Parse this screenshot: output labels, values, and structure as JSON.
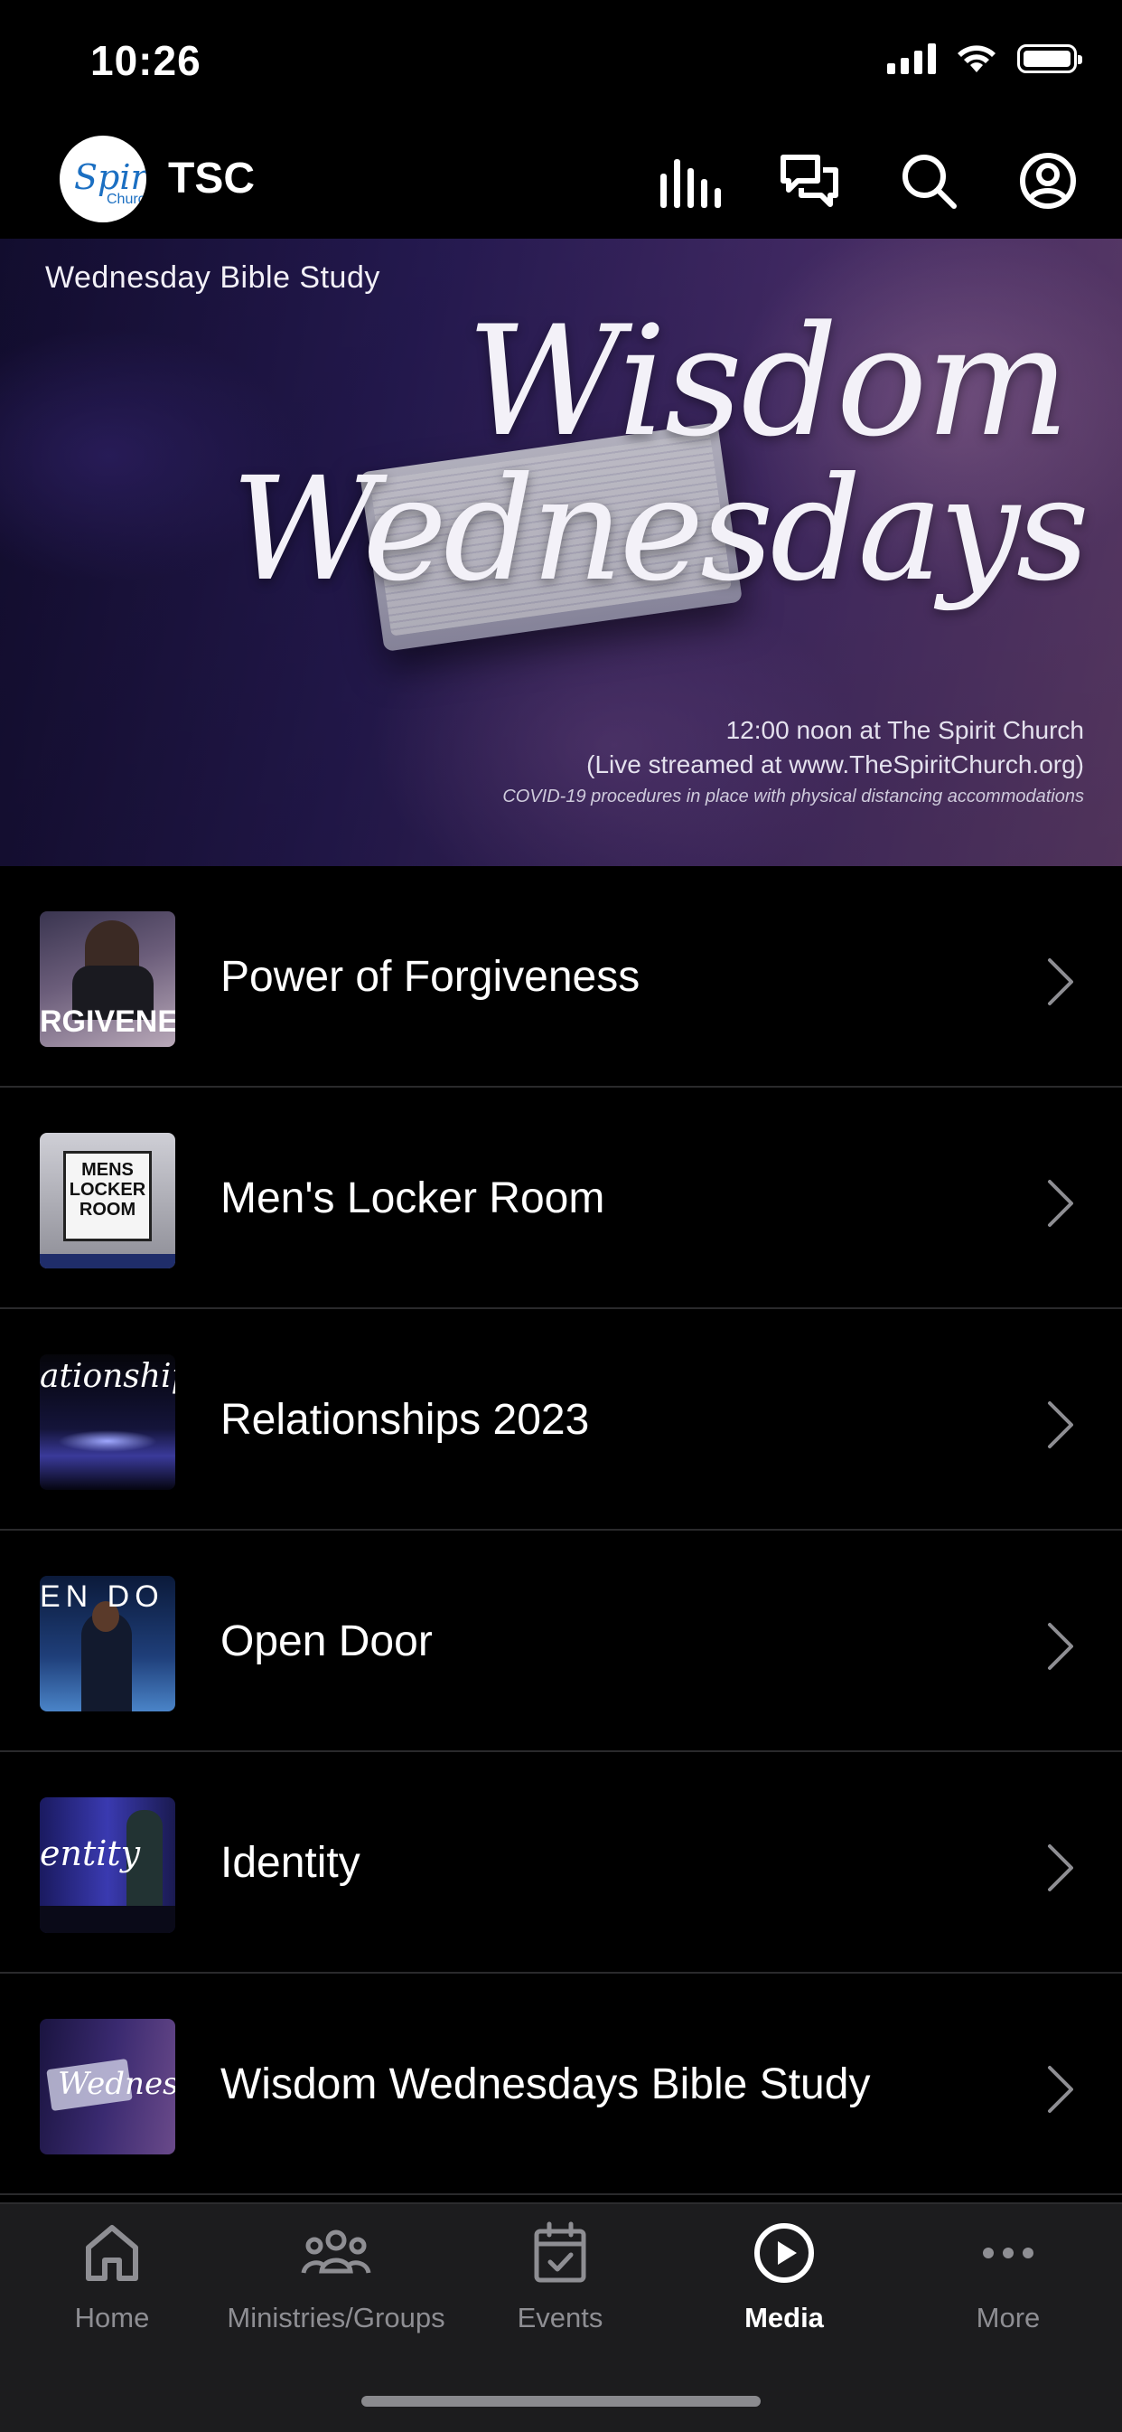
{
  "status_bar": {
    "time": "10:26",
    "icons": [
      "signal-icon",
      "wifi-icon",
      "battery-icon"
    ]
  },
  "header": {
    "logo_text": "Spiri",
    "logo_sub": "Churc",
    "title": "TSC",
    "actions": [
      "stats-icon",
      "chat-icon",
      "search-icon",
      "profile-icon"
    ]
  },
  "hero": {
    "label": "Wednesday Bible Study",
    "script_line1": "Wisdom",
    "script_line2": "Wednesdays",
    "info_line1": "12:00 noon at The Spirit Church",
    "info_line2": "(Live streamed at www.TheSpiritChurch.org)",
    "info_line3": "COVID-19 procedures in place with physical distancing accommodations"
  },
  "media_list": {
    "items": [
      {
        "title": "Power of Forgiveness",
        "thumb_text": "RGIVENE"
      },
      {
        "title": "Men's Locker Room",
        "thumb_text": "MENS LOCKER ROOM"
      },
      {
        "title": "Relationships 2023",
        "thumb_text": "ationships"
      },
      {
        "title": "Open Door",
        "thumb_text": "EN DO"
      },
      {
        "title": "Identity",
        "thumb_text": "entity"
      },
      {
        "title": "Wisdom Wednesdays Bible Study",
        "thumb_text": "Wedneso"
      }
    ]
  },
  "tab_bar": {
    "tabs": [
      {
        "label": "Home",
        "icon": "home-icon",
        "active": false
      },
      {
        "label": "Ministries/Groups",
        "icon": "groups-icon",
        "active": false
      },
      {
        "label": "Events",
        "icon": "calendar-icon",
        "active": false
      },
      {
        "label": "Media",
        "icon": "play-icon",
        "active": true
      },
      {
        "label": "More",
        "icon": "more-icon",
        "active": false
      }
    ]
  },
  "colors": {
    "background": "#000000",
    "tab_bar": "#1c1c1e",
    "inactive": "#8e8e93",
    "accent": "#ffffff",
    "logo_blue": "#1b6fc2"
  }
}
